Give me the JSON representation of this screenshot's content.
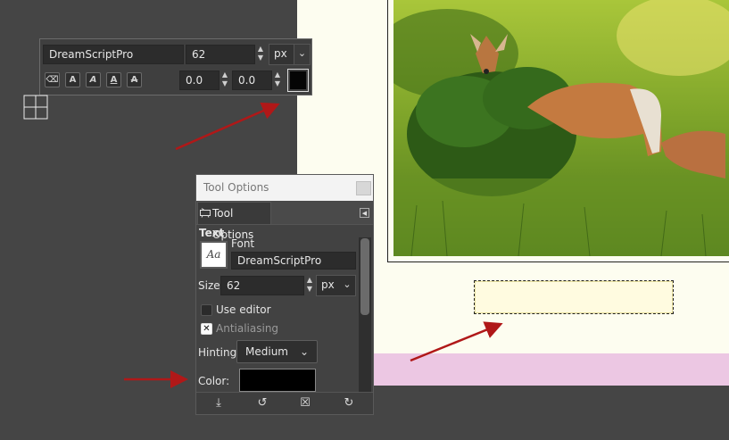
{
  "toolbar": {
    "font_value": "DreamScriptPro",
    "size_value": "62",
    "unit": "px",
    "offset_x": "0.0",
    "offset_y": "0.0",
    "style_buttons": [
      "⌫",
      "A",
      "A",
      "A",
      "A"
    ]
  },
  "dock": {
    "title": "Tool Options",
    "tab_label": "Tool Options",
    "section": "Text",
    "font_label": "Font",
    "font_value": "DreamScriptPro",
    "font_preview": "Aa",
    "size_label": "Size:",
    "size_value": "62",
    "unit": "px",
    "use_editor_label": "Use editor",
    "use_editor_checked": false,
    "antialiasing_label": "Antialiasing",
    "antialiasing_checked": true,
    "hinting_label": "Hinting:",
    "hinting_value": "Medium",
    "color_label": "Color:",
    "color_value": "#000000",
    "footer_buttons": [
      "save-icon",
      "reset-icon",
      "delete-icon",
      "restore-icon"
    ]
  },
  "colors": {
    "canvas_bg": "#454545",
    "page_bg": "#fdfdf0",
    "pink_strip": "#ecc7e3",
    "annotation_arrow": "#b01818"
  }
}
